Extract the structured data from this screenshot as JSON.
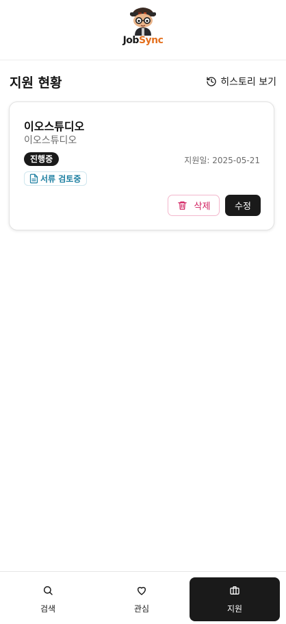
{
  "brand": {
    "logo_job": "Job",
    "logo_sync": "Sync",
    "accent_color": "#e4701e"
  },
  "page": {
    "title": "지원 현황",
    "history_label": "히스토리 보기",
    "history_icon": "history-icon"
  },
  "application": {
    "company": "이오스튜디오",
    "position": "이오스튜디오",
    "status": "진행중",
    "applied_date": "지원일: 2025-05-21",
    "stage": "서류 검토중",
    "stage_icon": "document-icon",
    "delete_label": "삭제",
    "delete_icon": "trash-icon",
    "edit_label": "수정",
    "delete_color": "#d11f5f",
    "stage_color": "#1c7fa1"
  },
  "nav": {
    "items": [
      {
        "label": "검색",
        "icon": "search-icon",
        "active": false
      },
      {
        "label": "관심",
        "icon": "heart-icon",
        "active": false
      },
      {
        "label": "지원",
        "icon": "briefcase-icon",
        "active": true
      }
    ]
  }
}
